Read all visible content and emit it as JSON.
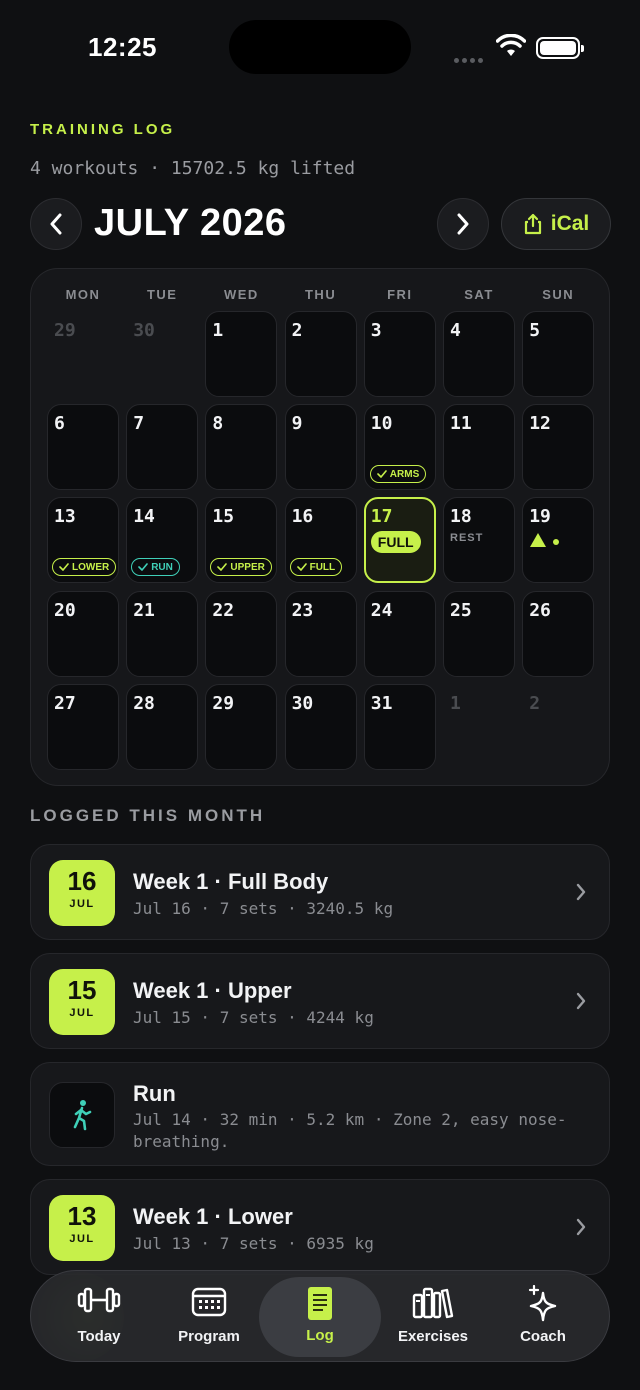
{
  "status_bar": {
    "time": "12:25"
  },
  "header": {
    "eyebrow": "TRAINING LOG",
    "summary": "4 workouts · 15702.5 kg lifted",
    "month_title": "JULY 2026",
    "ical_label": "iCal"
  },
  "calendar": {
    "weekdays": [
      "MON",
      "TUE",
      "WED",
      "THU",
      "FRI",
      "SAT",
      "SUN"
    ],
    "days": [
      {
        "n": "29",
        "off": true
      },
      {
        "n": "30",
        "off": true
      },
      {
        "n": "1"
      },
      {
        "n": "2"
      },
      {
        "n": "3"
      },
      {
        "n": "4"
      },
      {
        "n": "5"
      },
      {
        "n": "6"
      },
      {
        "n": "7"
      },
      {
        "n": "8"
      },
      {
        "n": "9"
      },
      {
        "n": "10",
        "tag": "ARMS"
      },
      {
        "n": "11"
      },
      {
        "n": "12"
      },
      {
        "n": "13",
        "tag": "LOWER"
      },
      {
        "n": "14",
        "tag": "RUN",
        "tag_kind": "run"
      },
      {
        "n": "15",
        "tag": "UPPER"
      },
      {
        "n": "16",
        "tag": "FULL"
      },
      {
        "n": "17",
        "today": true,
        "pill": "FULL"
      },
      {
        "n": "18",
        "note": "REST"
      },
      {
        "n": "19",
        "planned": true
      },
      {
        "n": "20"
      },
      {
        "n": "21"
      },
      {
        "n": "22"
      },
      {
        "n": "23"
      },
      {
        "n": "24"
      },
      {
        "n": "25"
      },
      {
        "n": "26"
      },
      {
        "n": "27"
      },
      {
        "n": "28"
      },
      {
        "n": "29"
      },
      {
        "n": "30"
      },
      {
        "n": "31"
      },
      {
        "n": "1",
        "off": true
      },
      {
        "n": "2",
        "off": true
      }
    ]
  },
  "logged": {
    "label": "LOGGED THIS MONTH",
    "items": [
      {
        "day": "16",
        "mon": "JUL",
        "title": "Week 1 · Full Body",
        "sub": "Jul 16 · 7 sets · 3240.5 kg"
      },
      {
        "day": "15",
        "mon": "JUL",
        "title": "Week 1 · Upper",
        "sub": "Jul 15 · 7 sets · 4244 kg"
      },
      {
        "title": "Run",
        "sub": "Jul 14 · 32 min · 5.2 km · Zone 2, easy nose-breathing.",
        "icon": "runner-icon"
      },
      {
        "day": "13",
        "mon": "JUL",
        "title": "Week 1 · Lower",
        "sub": "Jul 13 · 7 sets · 6935 kg"
      }
    ]
  },
  "tabs": [
    {
      "label": "Today",
      "icon": "dumbbell-icon"
    },
    {
      "label": "Program",
      "icon": "calendar-icon"
    },
    {
      "label": "Log",
      "icon": "notebook-icon",
      "active": true
    },
    {
      "label": "Exercises",
      "icon": "library-icon"
    },
    {
      "label": "Coach",
      "icon": "sparkle-icon"
    }
  ],
  "colors": {
    "accent": "#c6f04a",
    "run": "#3fd0b8",
    "background": "#0f1012"
  }
}
